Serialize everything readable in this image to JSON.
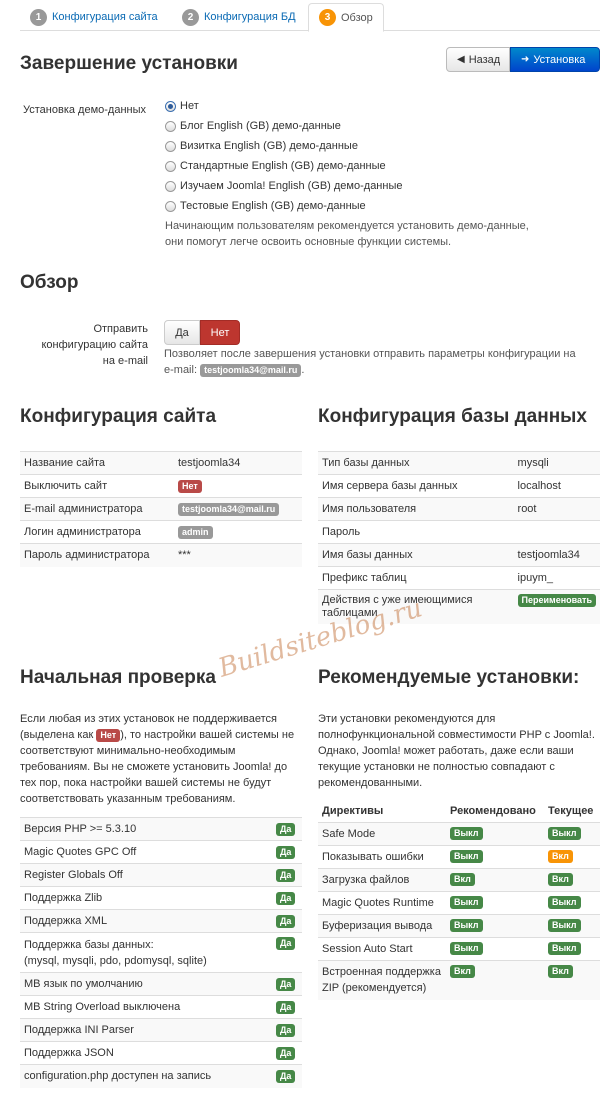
{
  "tabs": [
    {
      "num": "1",
      "label": "Конфигурация сайта"
    },
    {
      "num": "2",
      "label": "Конфигурация БД"
    },
    {
      "num": "3",
      "label": "Обзор"
    }
  ],
  "header": {
    "title": "Завершение установки",
    "back_label": "Назад",
    "install_label": "Установка"
  },
  "demo": {
    "label": "Установка демо-данных",
    "options": [
      "Нет",
      "Блог English (GB) демо-данные",
      "Визитка English (GB) демо-данные",
      "Стандартные English (GB) демо-данные",
      "Изучаем Joomla! English (GB) демо-данные",
      "Тестовые English (GB) демо-данные"
    ],
    "help1": "Начинающим пользователям рекомендуется установить демо-данные,",
    "help2": "они помогут легче освоить основные функции системы."
  },
  "overview": {
    "title": "Обзор",
    "send_label1": "Отправить",
    "send_label2": "конфигурацию сайта",
    "send_label3": "на e-mail",
    "yes": "Да",
    "no": "Нет",
    "help1": "Позволяет после завершения установки отправить параметры конфигурации на",
    "help2_prefix": "e-mail:",
    "email": "testjoomla34@mail.ru",
    "help2_suffix": "."
  },
  "site_config": {
    "title": "Конфигурация сайта",
    "rows": [
      {
        "k": "Название сайта",
        "v": "testjoomla34"
      },
      {
        "k": "Выключить сайт",
        "v": "Нет"
      },
      {
        "k": "E-mail администратора",
        "v": "testjoomla34@mail.ru"
      },
      {
        "k": "Логин администратора",
        "v": "admin"
      },
      {
        "k": "Пароль администратора",
        "v": "***"
      }
    ]
  },
  "db_config": {
    "title": "Конфигурация базы данных",
    "rows": [
      {
        "k": "Тип базы данных",
        "v": "mysqli"
      },
      {
        "k": "Имя сервера базы данных",
        "v": "localhost"
      },
      {
        "k": "Имя пользователя",
        "v": "root"
      },
      {
        "k": "Пароль",
        "v": ""
      },
      {
        "k": "Имя базы данных",
        "v": "testjoomla34"
      },
      {
        "k": "Префикс таблиц",
        "v": "ipuym_"
      },
      {
        "k1": "Действия с уже имеющимися",
        "k2": "таблицами",
        "v": "Переименовать"
      }
    ]
  },
  "precheck": {
    "title": "Начальная проверка",
    "intro": [
      "Если любая из этих установок не поддерживается",
      "(выделена как",
      "), то настройки вашей системы не",
      "соответствуют минимально-необходимым",
      "требованиям. Вы не сможете установить Joomla! до",
      "тех пор, пока настройки вашей системы не будут",
      "соответствовать указанным требованиям."
    ],
    "no_badge": "Нет",
    "rows": [
      {
        "k": "Версия PHP >= 5.3.10",
        "v": "Да"
      },
      {
        "k": "Magic Quotes GPC Off",
        "v": "Да"
      },
      {
        "k": "Register Globals Off",
        "v": "Да"
      },
      {
        "k": "Поддержка Zlib",
        "v": "Да"
      },
      {
        "k": "Поддержка XML",
        "v": "Да"
      },
      {
        "k1": "Поддержка базы данных:",
        "k2": "(mysql, mysqli, pdo, pdomysql, sqlite)",
        "v": "Да"
      },
      {
        "k": "MB язык по умолчанию",
        "v": "Да"
      },
      {
        "k": "MB String Overload выключена",
        "v": "Да"
      },
      {
        "k": "Поддержка INI Parser",
        "v": "Да"
      },
      {
        "k": "Поддержка JSON",
        "v": "Да"
      },
      {
        "k": "configuration.php доступен на запись",
        "v": "Да"
      }
    ]
  },
  "recommended": {
    "title": "Рекомендуемые установки:",
    "intro": [
      "Эти установки рекомендуются для",
      "полнофункциональной совместимости PHP с Joomla!.",
      "Однако, Joomla! может работать, даже если ваши",
      "текущие установки не полностью совпадают с",
      "рекомендованными."
    ],
    "headers": [
      "Директивы",
      "Рекомендовано",
      "Текущее"
    ],
    "rows": [
      {
        "k": "Safe Mode",
        "rec": "Выкл",
        "cur": "Выкл",
        "cur_color": "#468847"
      },
      {
        "k": "Показывать ошибки",
        "rec": "Выкл",
        "cur": "Вкл",
        "cur_color": "#f89406"
      },
      {
        "k": "Загрузка файлов",
        "rec": "Вкл",
        "cur": "Вкл",
        "cur_color": "#468847"
      },
      {
        "k": "Magic Quotes Runtime",
        "rec": "Выкл",
        "cur": "Выкл",
        "cur_color": "#468847"
      },
      {
        "k": "Буферизация вывода",
        "rec": "Выкл",
        "cur": "Выкл",
        "cur_color": "#468847"
      },
      {
        "k": "Session Auto Start",
        "rec": "Выкл",
        "cur": "Выкл",
        "cur_color": "#468847"
      },
      {
        "k1": "Встроенная поддержка",
        "k2": "ZIP (рекомендуется)",
        "rec": "Вкл",
        "cur": "Вкл",
        "cur_color": "#468847"
      }
    ]
  },
  "watermark": "Buildsiteblog.ru"
}
